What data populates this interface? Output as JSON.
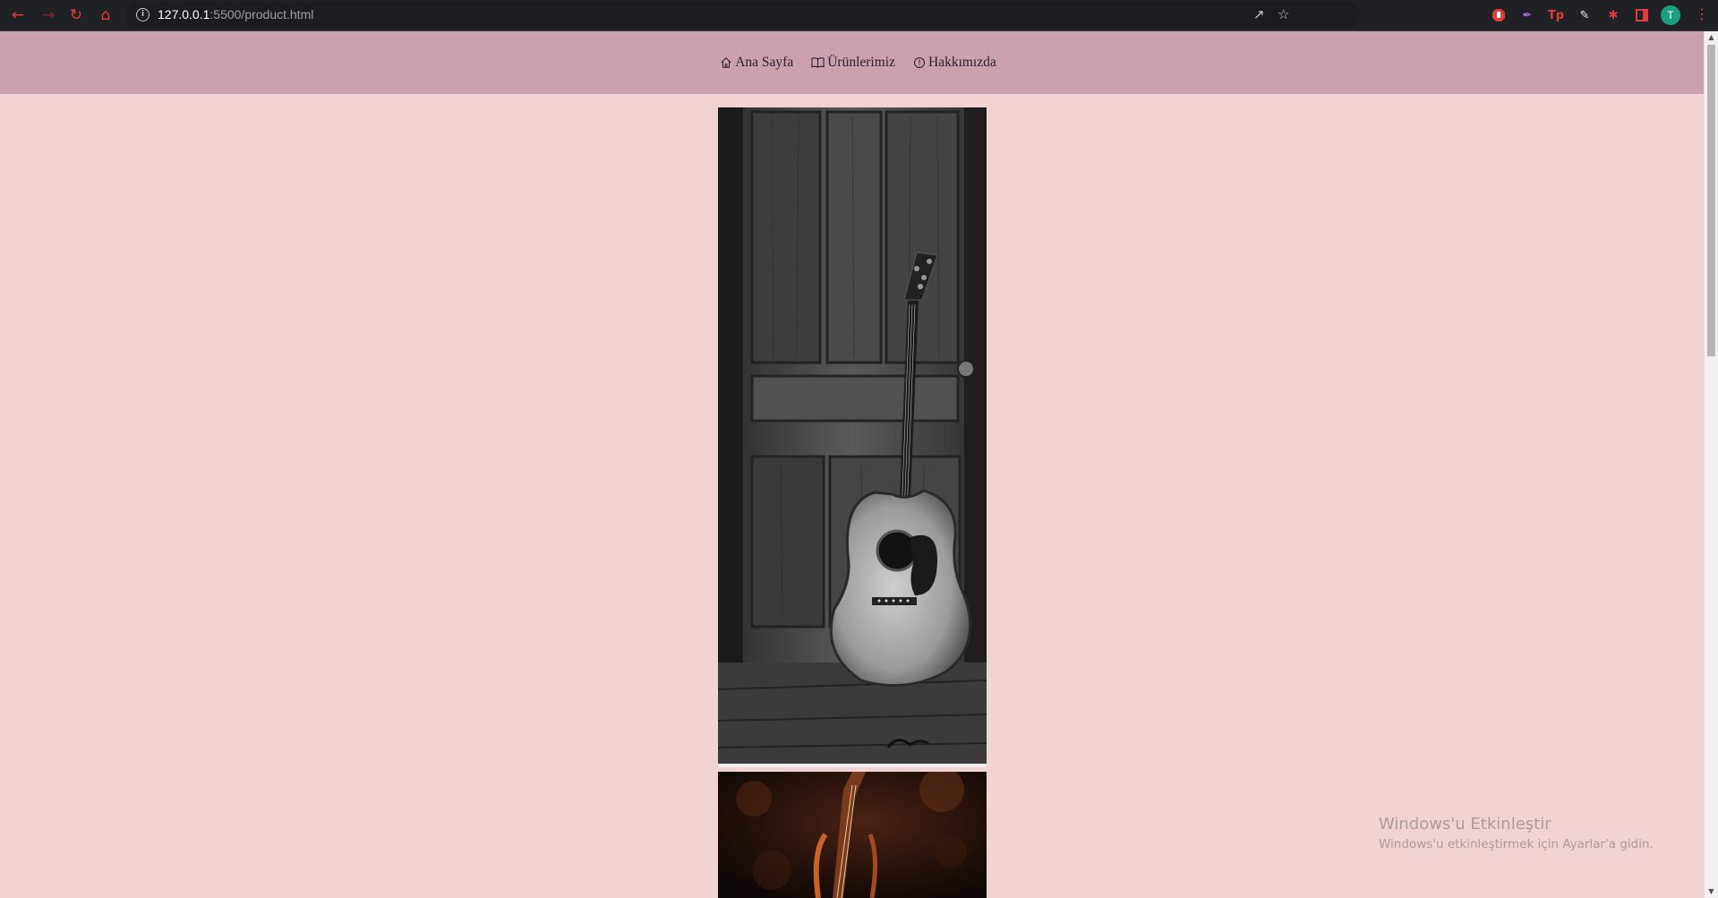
{
  "browser": {
    "url_host": "127.0.0.1",
    "url_rest": ":5500/product.html",
    "profile_initial": "T",
    "extensions": [
      "Tp"
    ]
  },
  "nav": {
    "items": [
      {
        "label": "Ana Sayfa",
        "icon": "home-icon"
      },
      {
        "label": "Ürünlerimiz",
        "icon": "book-icon"
      },
      {
        "label": "Hakkımızda",
        "icon": "info-icon"
      }
    ]
  },
  "products": [
    {
      "image": "acoustic-guitar-photo",
      "description": "Black and white acoustic guitar leaning against a wooden door"
    },
    {
      "image": "violin-photo",
      "description": "Violin on dark brown background"
    }
  ],
  "watermark": {
    "title": "Windows'u Etkinleştir",
    "subtitle": "Windows'u etkinleştirmek için Ayarlar'a gidin."
  },
  "colors": {
    "page_background": "#f1d3d3",
    "header_background": "#cba1ae",
    "chrome_background": "#202124",
    "accent_red": "#e23b3b"
  }
}
